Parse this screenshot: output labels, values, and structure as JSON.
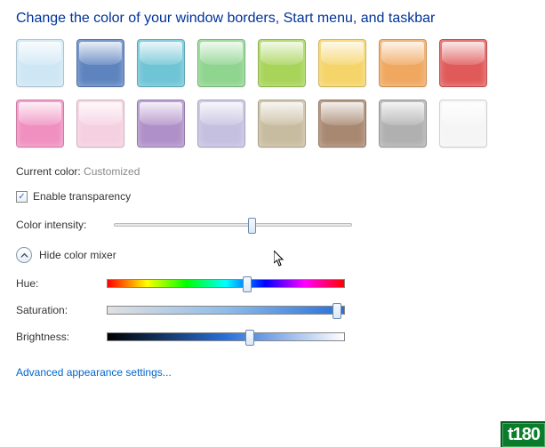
{
  "title": "Change the color of your window borders, Start menu, and taskbar",
  "swatches": [
    {
      "name": "sky",
      "color": "#cfe7f5"
    },
    {
      "name": "twilight",
      "color": "#5e84c0"
    },
    {
      "name": "sea",
      "color": "#6fc5d6"
    },
    {
      "name": "leaf",
      "color": "#8fd48f"
    },
    {
      "name": "lime",
      "color": "#a8d45a"
    },
    {
      "name": "sun",
      "color": "#f5d46a"
    },
    {
      "name": "pumpkin",
      "color": "#f0a860"
    },
    {
      "name": "ruby",
      "color": "#e05a5a"
    },
    {
      "name": "fuchsia",
      "color": "#f090c0"
    },
    {
      "name": "blush",
      "color": "#f5d0e0"
    },
    {
      "name": "violet",
      "color": "#b090c8"
    },
    {
      "name": "lavender",
      "color": "#c5c0e0"
    },
    {
      "name": "taupe",
      "color": "#c8bca0"
    },
    {
      "name": "chocolate",
      "color": "#a88870"
    },
    {
      "name": "slate",
      "color": "#b0b0b0"
    },
    {
      "name": "frost",
      "color": "#f5f5f5"
    }
  ],
  "current": {
    "label": "Current color:",
    "value": "Customized"
  },
  "transparency": {
    "label": "Enable transparency",
    "checked": true
  },
  "intensity": {
    "label": "Color intensity:",
    "value": 58
  },
  "mixer_toggle": "Hide color mixer",
  "mixer": {
    "hue": {
      "label": "Hue:",
      "value": 59
    },
    "saturation": {
      "label": "Saturation:",
      "value": 98
    },
    "brightness": {
      "label": "Brightness:",
      "value": 60
    }
  },
  "advanced_link": "Advanced appearance settings...",
  "badge": "t180"
}
